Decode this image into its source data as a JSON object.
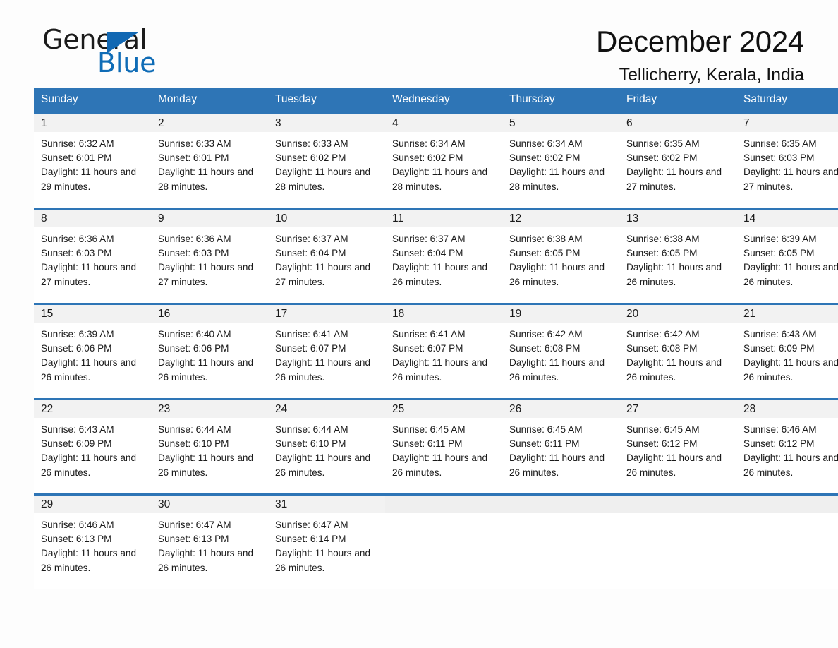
{
  "brand": {
    "name_part1": "General",
    "name_part2": "Blue",
    "logo_icon": "triangle-icon"
  },
  "header": {
    "month_title": "December 2024",
    "location": "Tellicherry, Kerala, India"
  },
  "colors": {
    "header_blue": "#2e75b6",
    "logo_blue": "#0f6cb6",
    "daynum_band": "#f2f2f2",
    "page_background": "#fdfdfd",
    "text": "#1a1a1a"
  },
  "calendar": {
    "weekday_headers": [
      "Sunday",
      "Monday",
      "Tuesday",
      "Wednesday",
      "Thursday",
      "Friday",
      "Saturday"
    ],
    "weeks": [
      [
        {
          "day": "1",
          "sunrise": "Sunrise: 6:32 AM",
          "sunset": "Sunset: 6:01 PM",
          "daylight": "Daylight: 11 hours and 29 minutes."
        },
        {
          "day": "2",
          "sunrise": "Sunrise: 6:33 AM",
          "sunset": "Sunset: 6:01 PM",
          "daylight": "Daylight: 11 hours and 28 minutes."
        },
        {
          "day": "3",
          "sunrise": "Sunrise: 6:33 AM",
          "sunset": "Sunset: 6:02 PM",
          "daylight": "Daylight: 11 hours and 28 minutes."
        },
        {
          "day": "4",
          "sunrise": "Sunrise: 6:34 AM",
          "sunset": "Sunset: 6:02 PM",
          "daylight": "Daylight: 11 hours and 28 minutes."
        },
        {
          "day": "5",
          "sunrise": "Sunrise: 6:34 AM",
          "sunset": "Sunset: 6:02 PM",
          "daylight": "Daylight: 11 hours and 28 minutes."
        },
        {
          "day": "6",
          "sunrise": "Sunrise: 6:35 AM",
          "sunset": "Sunset: 6:02 PM",
          "daylight": "Daylight: 11 hours and 27 minutes."
        },
        {
          "day": "7",
          "sunrise": "Sunrise: 6:35 AM",
          "sunset": "Sunset: 6:03 PM",
          "daylight": "Daylight: 11 hours and 27 minutes."
        }
      ],
      [
        {
          "day": "8",
          "sunrise": "Sunrise: 6:36 AM",
          "sunset": "Sunset: 6:03 PM",
          "daylight": "Daylight: 11 hours and 27 minutes."
        },
        {
          "day": "9",
          "sunrise": "Sunrise: 6:36 AM",
          "sunset": "Sunset: 6:03 PM",
          "daylight": "Daylight: 11 hours and 27 minutes."
        },
        {
          "day": "10",
          "sunrise": "Sunrise: 6:37 AM",
          "sunset": "Sunset: 6:04 PM",
          "daylight": "Daylight: 11 hours and 27 minutes."
        },
        {
          "day": "11",
          "sunrise": "Sunrise: 6:37 AM",
          "sunset": "Sunset: 6:04 PM",
          "daylight": "Daylight: 11 hours and 26 minutes."
        },
        {
          "day": "12",
          "sunrise": "Sunrise: 6:38 AM",
          "sunset": "Sunset: 6:05 PM",
          "daylight": "Daylight: 11 hours and 26 minutes."
        },
        {
          "day": "13",
          "sunrise": "Sunrise: 6:38 AM",
          "sunset": "Sunset: 6:05 PM",
          "daylight": "Daylight: 11 hours and 26 minutes."
        },
        {
          "day": "14",
          "sunrise": "Sunrise: 6:39 AM",
          "sunset": "Sunset: 6:05 PM",
          "daylight": "Daylight: 11 hours and 26 minutes."
        }
      ],
      [
        {
          "day": "15",
          "sunrise": "Sunrise: 6:39 AM",
          "sunset": "Sunset: 6:06 PM",
          "daylight": "Daylight: 11 hours and 26 minutes."
        },
        {
          "day": "16",
          "sunrise": "Sunrise: 6:40 AM",
          "sunset": "Sunset: 6:06 PM",
          "daylight": "Daylight: 11 hours and 26 minutes."
        },
        {
          "day": "17",
          "sunrise": "Sunrise: 6:41 AM",
          "sunset": "Sunset: 6:07 PM",
          "daylight": "Daylight: 11 hours and 26 minutes."
        },
        {
          "day": "18",
          "sunrise": "Sunrise: 6:41 AM",
          "sunset": "Sunset: 6:07 PM",
          "daylight": "Daylight: 11 hours and 26 minutes."
        },
        {
          "day": "19",
          "sunrise": "Sunrise: 6:42 AM",
          "sunset": "Sunset: 6:08 PM",
          "daylight": "Daylight: 11 hours and 26 minutes."
        },
        {
          "day": "20",
          "sunrise": "Sunrise: 6:42 AM",
          "sunset": "Sunset: 6:08 PM",
          "daylight": "Daylight: 11 hours and 26 minutes."
        },
        {
          "day": "21",
          "sunrise": "Sunrise: 6:43 AM",
          "sunset": "Sunset: 6:09 PM",
          "daylight": "Daylight: 11 hours and 26 minutes."
        }
      ],
      [
        {
          "day": "22",
          "sunrise": "Sunrise: 6:43 AM",
          "sunset": "Sunset: 6:09 PM",
          "daylight": "Daylight: 11 hours and 26 minutes."
        },
        {
          "day": "23",
          "sunrise": "Sunrise: 6:44 AM",
          "sunset": "Sunset: 6:10 PM",
          "daylight": "Daylight: 11 hours and 26 minutes."
        },
        {
          "day": "24",
          "sunrise": "Sunrise: 6:44 AM",
          "sunset": "Sunset: 6:10 PM",
          "daylight": "Daylight: 11 hours and 26 minutes."
        },
        {
          "day": "25",
          "sunrise": "Sunrise: 6:45 AM",
          "sunset": "Sunset: 6:11 PM",
          "daylight": "Daylight: 11 hours and 26 minutes."
        },
        {
          "day": "26",
          "sunrise": "Sunrise: 6:45 AM",
          "sunset": "Sunset: 6:11 PM",
          "daylight": "Daylight: 11 hours and 26 minutes."
        },
        {
          "day": "27",
          "sunrise": "Sunrise: 6:45 AM",
          "sunset": "Sunset: 6:12 PM",
          "daylight": "Daylight: 11 hours and 26 minutes."
        },
        {
          "day": "28",
          "sunrise": "Sunrise: 6:46 AM",
          "sunset": "Sunset: 6:12 PM",
          "daylight": "Daylight: 11 hours and 26 minutes."
        }
      ],
      [
        {
          "day": "29",
          "sunrise": "Sunrise: 6:46 AM",
          "sunset": "Sunset: 6:13 PM",
          "daylight": "Daylight: 11 hours and 26 minutes."
        },
        {
          "day": "30",
          "sunrise": "Sunrise: 6:47 AM",
          "sunset": "Sunset: 6:13 PM",
          "daylight": "Daylight: 11 hours and 26 minutes."
        },
        {
          "day": "31",
          "sunrise": "Sunrise: 6:47 AM",
          "sunset": "Sunset: 6:14 PM",
          "daylight": "Daylight: 11 hours and 26 minutes."
        },
        {
          "day": "",
          "sunrise": "",
          "sunset": "",
          "daylight": ""
        },
        {
          "day": "",
          "sunrise": "",
          "sunset": "",
          "daylight": ""
        },
        {
          "day": "",
          "sunrise": "",
          "sunset": "",
          "daylight": ""
        },
        {
          "day": "",
          "sunrise": "",
          "sunset": "",
          "daylight": ""
        }
      ]
    ]
  }
}
